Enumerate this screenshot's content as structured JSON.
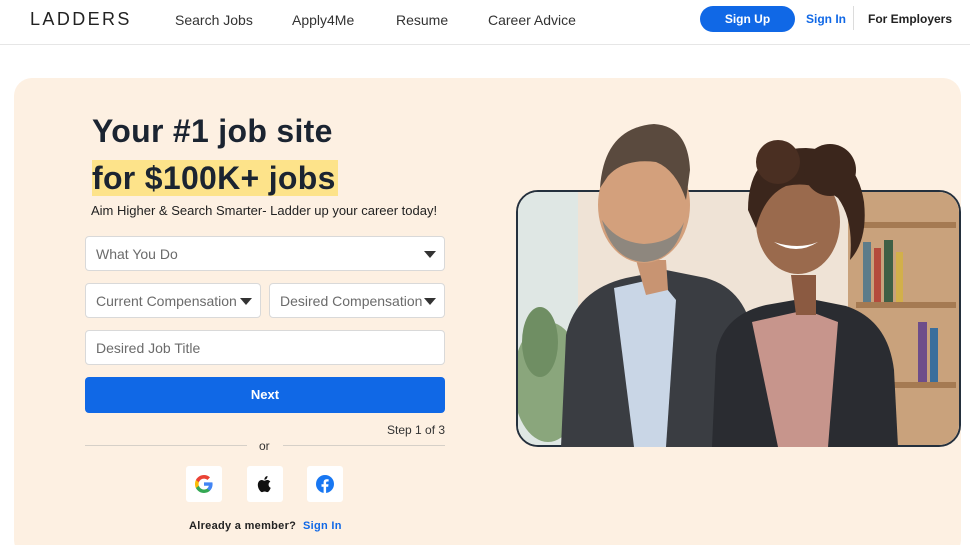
{
  "nav": {
    "logo": "LADDERS",
    "links": [
      "Search Jobs",
      "Apply4Me",
      "Resume",
      "Career Advice"
    ],
    "sign_up": "Sign Up",
    "sign_in": "Sign In",
    "employers": "For Employers"
  },
  "hero": {
    "headline_line1": "Your #1 job site",
    "headline_line2": "for $100K+ jobs",
    "subline": "Aim Higher & Search Smarter- Ladder up your career today!",
    "form": {
      "what_you_do": "What You Do",
      "current_compensation": "Current Compensation",
      "desired_compensation": "Desired Compensation",
      "desired_job_title": "Desired Job Title",
      "next": "Next",
      "step": "Step 1 of 3",
      "or": "or"
    },
    "social": [
      {
        "name": "google-icon"
      },
      {
        "name": "apple-icon"
      },
      {
        "name": "facebook-icon"
      }
    ],
    "member_text": "Already a member?",
    "member_link": "Sign In"
  },
  "colors": {
    "brand_blue": "#1068e6",
    "hero_bg": "#fdf0e2",
    "highlight": "#fde38a",
    "text_dark": "#1b2431"
  }
}
